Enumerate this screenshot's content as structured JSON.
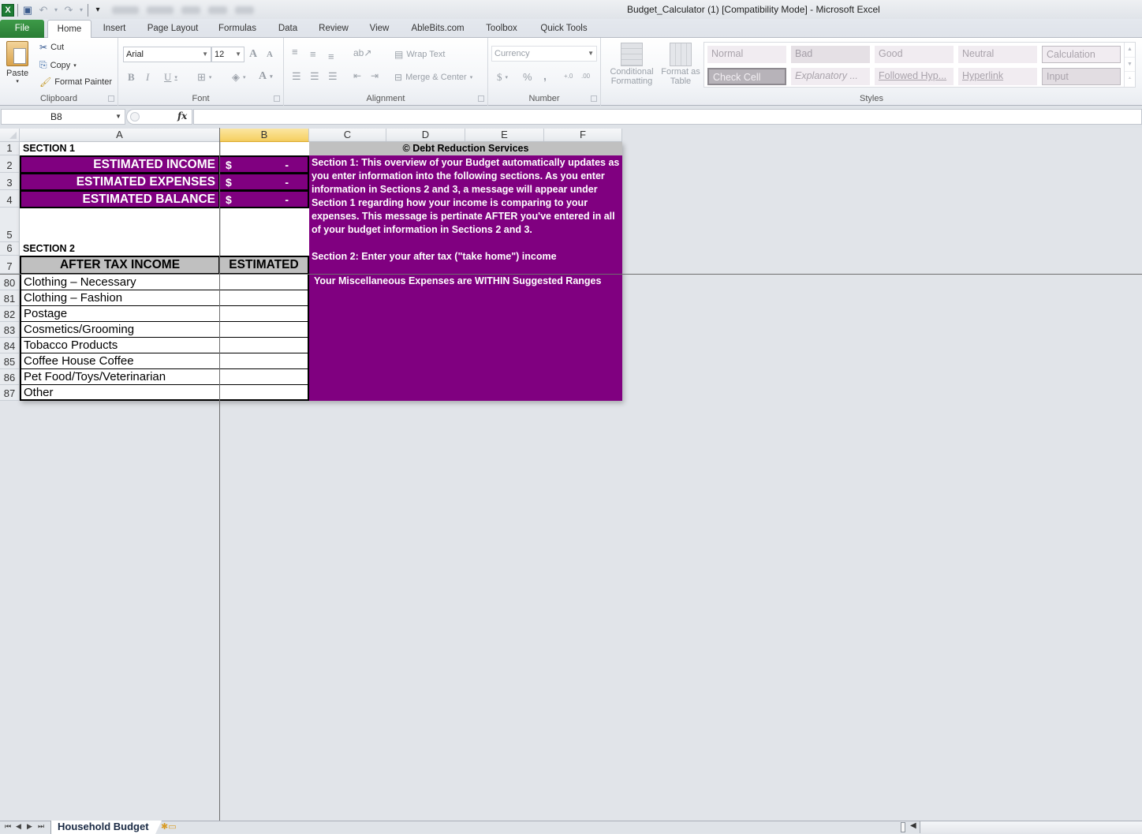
{
  "window": {
    "title": "Budget_Calculator (1)  [Compatibility Mode]  -  Microsoft Excel",
    "app_icon": "excel-icon",
    "quick_access": [
      {
        "name": "save-icon",
        "glyph": "💾"
      },
      {
        "name": "undo-icon",
        "glyph": "↶"
      },
      {
        "name": "redo-icon",
        "glyph": "↷"
      },
      {
        "name": "customize-qat-icon",
        "glyph": "▾"
      }
    ]
  },
  "ribbon_tabs": [
    {
      "label": "File"
    },
    {
      "label": "Home"
    },
    {
      "label": "Insert"
    },
    {
      "label": "Page Layout"
    },
    {
      "label": "Formulas"
    },
    {
      "label": "Data"
    },
    {
      "label": "Review"
    },
    {
      "label": "View"
    },
    {
      "label": "AbleBits.com"
    },
    {
      "label": "Toolbox"
    },
    {
      "label": "Quick Tools"
    }
  ],
  "active_tab": "Home",
  "ribbon": {
    "clipboard": {
      "group_label": "Clipboard",
      "paste": "Paste",
      "cut": "Cut",
      "copy": "Copy",
      "format_painter": "Format Painter"
    },
    "font": {
      "group_label": "Font",
      "font_name": "Arial",
      "font_size": "12",
      "bold": "B",
      "italic": "I",
      "underline": "U",
      "grow": "A",
      "shrink": "A",
      "font_color": "A"
    },
    "alignment": {
      "group_label": "Alignment",
      "wrap_text": "Wrap Text",
      "merge_center": "Merge & Center"
    },
    "number": {
      "group_label": "Number",
      "format": "Currency",
      "currency": "$",
      "percent": "%",
      "comma": ",",
      "inc_decimal": "+.0",
      "dec_decimal": ".00"
    },
    "styles": {
      "group_label": "Styles",
      "conditional_formatting": "Conditional Formatting",
      "format_as_table": "Format as Table",
      "gallery": [
        "Normal",
        "Bad",
        "Good",
        "Neutral",
        "Calculation",
        "Check Cell",
        "Explanatory ...",
        "Followed Hyp...",
        "Hyperlink",
        "Input"
      ]
    }
  },
  "formula_bar": {
    "name_box": "B8",
    "fx": "fx",
    "formula": ""
  },
  "columns": [
    "A",
    "B",
    "C",
    "D",
    "E",
    "F"
  ],
  "selected_column": "B",
  "sheet": {
    "section1_label": "SECTION 1",
    "copyright": "© Debt Reduction Services",
    "summary": [
      {
        "row": "2",
        "label": "ESTIMATED INCOME",
        "currency": "$",
        "value": "-"
      },
      {
        "row": "3",
        "label": "ESTIMATED EXPENSES",
        "currency": "$",
        "value": "-"
      },
      {
        "row": "4",
        "label": "ESTIMATED BALANCE",
        "currency": "$",
        "value": "-"
      }
    ],
    "section2_label": "SECTION 2",
    "table_header": {
      "col_a": "AFTER TAX INCOME",
      "col_b": "ESTIMATED"
    },
    "instructions": "Section 1: This overview of your Budget automatically updates as you enter information into the following sections. As you enter information in Sections 2 and 3, a message will appear under Section 1 regarding how your income is comparing to your expenses. This message is pertinate AFTER you've entered in all of your budget information in Sections 2 and 3.",
    "instructions_2": "Section 2: Enter your after tax (\"take home\") income",
    "status_message": "Your Miscellaneous Expenses are WITHIN Suggested Ranges",
    "items": [
      {
        "row": "80",
        "label": "Clothing – Necessary",
        "value": ""
      },
      {
        "row": "81",
        "label": "Clothing – Fashion",
        "value": ""
      },
      {
        "row": "82",
        "label": "Postage",
        "value": ""
      },
      {
        "row": "83",
        "label": "Cosmetics/Grooming",
        "value": ""
      },
      {
        "row": "84",
        "label": "Tobacco Products",
        "value": ""
      },
      {
        "row": "85",
        "label": "Coffee House Coffee",
        "value": ""
      },
      {
        "row": "86",
        "label": "Pet Food/Toys/Veterinarian",
        "value": ""
      },
      {
        "row": "87",
        "label": "Other",
        "value": ""
      }
    ],
    "row_numbers": {
      "r1": "1",
      "r5": "5",
      "r6": "6",
      "r7": "7"
    }
  },
  "sheet_tabs": [
    {
      "label": "Household Budget",
      "active": true
    }
  ],
  "colors": {
    "accent_purple": "#800080",
    "header_gray": "#c0c0c0",
    "file_tab_green": "#2a7d35",
    "selected_col_header": "#f6cf60"
  }
}
